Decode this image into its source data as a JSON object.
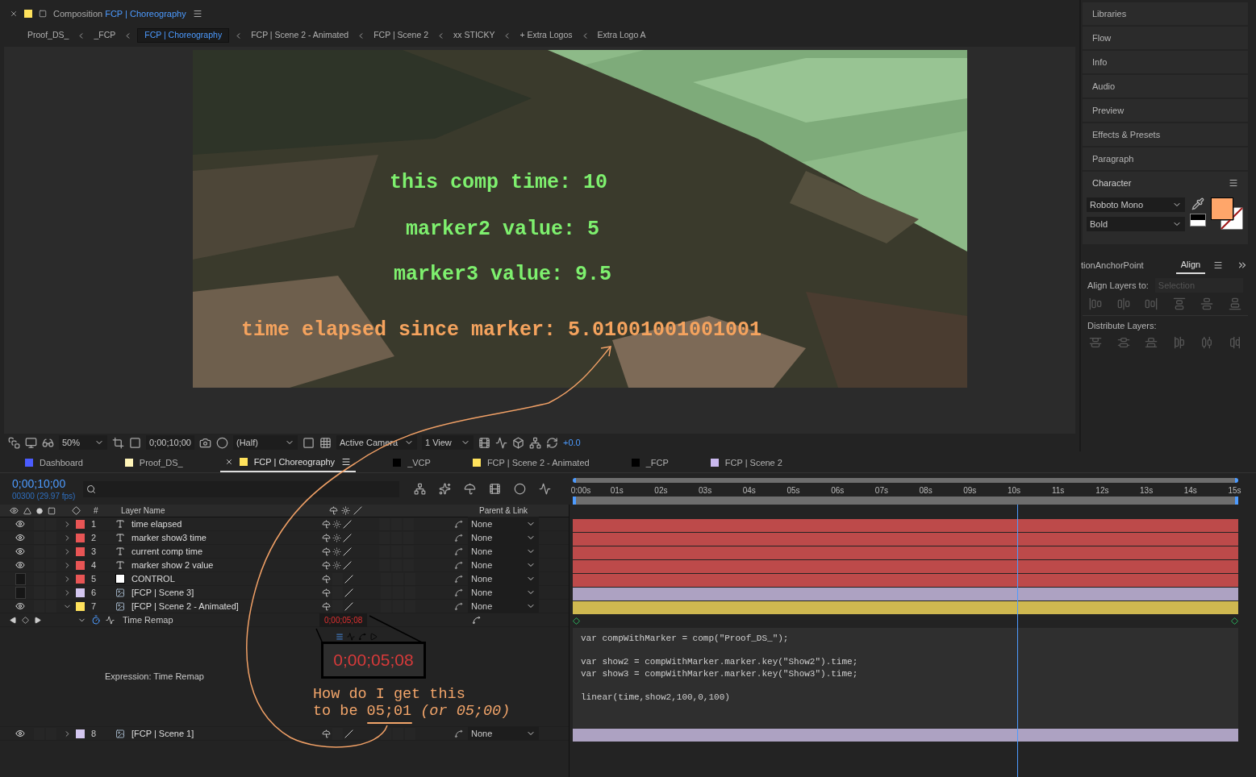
{
  "composition_panel": {
    "header": {
      "prefix": "Composition",
      "title": "FCP | Choreography"
    },
    "breadcrumbs": [
      {
        "label": "Proof_DS_",
        "selected": false
      },
      {
        "label": "_FCP",
        "selected": false
      },
      {
        "label": "FCP | Choreography",
        "selected": true
      },
      {
        "label": "FCP | Scene 2 - Animated",
        "selected": false
      },
      {
        "label": "FCP | Scene 2",
        "selected": false
      },
      {
        "label": "xx STICKY",
        "selected": false
      },
      {
        "label": "+ Extra Logos",
        "selected": false
      },
      {
        "label": "Extra Logo A",
        "selected": false
      }
    ],
    "viewer": {
      "texts": [
        {
          "text": "this comp time: 10",
          "color": "#7ef06e"
        },
        {
          "text": "marker2 value: 5",
          "color": "#7ef06e"
        },
        {
          "text": "marker3 value: 9.5",
          "color": "#7ef06e"
        },
        {
          "text": "time elapsed since marker: 5.01001001001001",
          "color": "#f5a35e"
        }
      ]
    },
    "toolbar": {
      "zoom": "50%",
      "timecode": "0;00;10;00",
      "resolution": "(Half)",
      "camera": "Active Camera",
      "views": "1 View",
      "exposure": "+0.0"
    }
  },
  "side_panels": {
    "items": [
      "Libraries",
      "Flow",
      "Info",
      "Audio",
      "Preview",
      "Effects & Presets",
      "Paragraph"
    ],
    "character": {
      "title": "Character",
      "font": "Roboto Mono",
      "style": "Bold",
      "color": "#ffa66a"
    },
    "tabs": [
      {
        "label": "tionAnchorPoint",
        "selected": false
      },
      {
        "label": "Align",
        "selected": true
      }
    ],
    "align": {
      "align_label": "Align Layers to:",
      "align_to": "Selection",
      "distribute_label": "Distribute Layers:"
    }
  },
  "timeline": {
    "tabs": [
      {
        "label": "Dashboard",
        "color": "#4b5cff",
        "selected": false
      },
      {
        "label": "Proof_DS_",
        "color": "#fff4b8",
        "selected": false
      },
      {
        "label": "FCP | Choreography",
        "color": "#ffe25c",
        "selected": true
      },
      {
        "label": "_VCP",
        "color": "#000000",
        "selected": false
      },
      {
        "label": "FCP | Scene 2 - Animated",
        "color": "#ffe25c",
        "selected": false
      },
      {
        "label": "_FCP",
        "color": "#000000",
        "selected": false
      },
      {
        "label": "FCP | Scene 2",
        "color": "#c9b8ee",
        "selected": false
      }
    ],
    "timecode": "0;00;10;00",
    "frames": "00300 (29.97 fps)",
    "columns": [
      "#",
      "Layer Name",
      "Parent & Link"
    ],
    "ruler": [
      "0:00s",
      "01s",
      "02s",
      "03s",
      "04s",
      "05s",
      "06s",
      "07s",
      "08s",
      "09s",
      "10s",
      "11s",
      "12s",
      "13s",
      "14s",
      "15s"
    ],
    "layers": [
      {
        "number": "1",
        "name": "time elapsed",
        "kind": "text",
        "color": "#e85555",
        "visible": true,
        "expanded": false,
        "parent": "None"
      },
      {
        "number": "2",
        "name": "marker show3 time",
        "kind": "text",
        "color": "#e85555",
        "visible": true,
        "expanded": false,
        "parent": "None"
      },
      {
        "number": "3",
        "name": "current comp time",
        "kind": "text",
        "color": "#e85555",
        "visible": true,
        "expanded": false,
        "parent": "None"
      },
      {
        "number": "4",
        "name": "marker show 2 value",
        "kind": "text",
        "color": "#e85555",
        "visible": true,
        "expanded": false,
        "parent": "None"
      },
      {
        "number": "5",
        "name": "CONTROL",
        "kind": "solid",
        "color": "#e85555",
        "visible": false,
        "expanded": false,
        "parent": "None"
      },
      {
        "number": "6",
        "name": "[FCP | Scene 3]",
        "kind": "comp",
        "color": "#d3c6ef",
        "visible": false,
        "expanded": false,
        "parent": "None"
      },
      {
        "number": "7",
        "name": "[FCP | Scene 2 - Animated]",
        "kind": "comp",
        "color": "#ffe25c",
        "visible": true,
        "expanded": true,
        "parent": "None",
        "property": {
          "name": "Time Remap",
          "value": "0;00;05;08"
        },
        "expression": {
          "label": "Expression: Time Remap",
          "code_blocks": [
            [
              "var compWithMarker = comp(\"Proof_DS_\");"
            ],
            [
              "var show2 = compWithMarker.marker.key(\"Show2\").time;",
              "var show3 = compWithMarker.marker.key(\"Show3\").time;"
            ],
            [
              "linear(time,show2,100,0,100)"
            ]
          ]
        }
      },
      {
        "number": "8",
        "name": "[FCP | Scene 1]",
        "kind": "comp",
        "color": "#d3c6ef",
        "visible": true,
        "expanded": false,
        "parent": "None"
      }
    ]
  },
  "annotation": {
    "magnified_value": "0;00;05;08",
    "question": [
      "How do I get this",
      "to be 05;01 *(or 05;00)*"
    ]
  }
}
